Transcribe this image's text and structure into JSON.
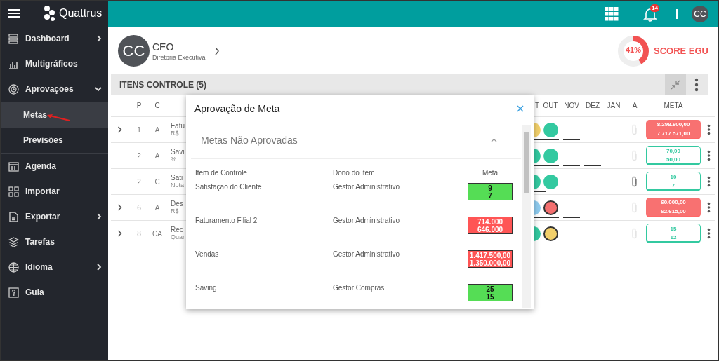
{
  "brand": "Quattrus",
  "sidebar": {
    "items": [
      {
        "label": "Dashboard",
        "submenu": true,
        "expanded": false
      },
      {
        "label": "Multigráficos",
        "submenu": false
      },
      {
        "label": "Aprovações",
        "submenu": true,
        "expanded": true,
        "children": [
          {
            "label": "Metas",
            "selected": true
          },
          {
            "label": "Previsões",
            "selected": false
          }
        ]
      },
      {
        "label": "Agenda",
        "submenu": false
      },
      {
        "label": "Importar",
        "submenu": false
      },
      {
        "label": "Exportar",
        "submenu": true,
        "expanded": false
      },
      {
        "label": "Tarefas",
        "submenu": false
      },
      {
        "label": "Idioma",
        "submenu": true,
        "expanded": false
      },
      {
        "label": "Guia",
        "submenu": false
      }
    ]
  },
  "topbar": {
    "notifications": "14",
    "avatar": "CC"
  },
  "profile": {
    "avatar": "CC",
    "role": "CEO",
    "department": "Diretoria Executiva"
  },
  "score": {
    "reading": "41%",
    "level": 0.41,
    "label": "SCORE EGU"
  },
  "section": {
    "title": "ITENS CONTROLE (5)"
  },
  "table": {
    "columns": [
      "P",
      "C",
      "T",
      "OUT",
      "NOV",
      "DEZ",
      "JAN",
      "A",
      "META"
    ],
    "rows": [
      {
        "p": "1",
        "c": "A",
        "name": "Fatu",
        "unit": "R$",
        "expandable": true,
        "months": [
          {
            "kind": "circle",
            "color": "#f2d06b",
            "underline": true,
            "outlined": false
          },
          {
            "kind": "circle",
            "color": "#33c9a0",
            "underline": true,
            "outlined": false
          },
          {
            "kind": "dash"
          },
          {
            "kind": "empty"
          },
          {
            "kind": "empty"
          }
        ],
        "attachment": false,
        "meta": {
          "met": false,
          "target": "8.298.800,00",
          "actual": "7.717.571,00"
        }
      },
      {
        "p": "2",
        "c": "A",
        "name": "Savi",
        "unit": "%",
        "expandable": false,
        "months": [
          {
            "kind": "circle",
            "color": "#33c9a0",
            "underline": true,
            "outlined": false
          },
          {
            "kind": "circle",
            "color": "#33c9a0",
            "underline": true,
            "outlined": false
          },
          {
            "kind": "dash"
          },
          {
            "kind": "dash"
          },
          {
            "kind": "empty"
          }
        ],
        "attachment": false,
        "meta": {
          "met": true,
          "target": "70,00",
          "actual": "50,00"
        }
      },
      {
        "p": "2",
        "c": "C",
        "name": "Sati",
        "unit": "Nota",
        "expandable": false,
        "months": [
          {
            "kind": "circle",
            "color": "#33c9a0",
            "underline": true,
            "outlined": false
          },
          {
            "kind": "circle",
            "color": "#33c9a0",
            "underline": false,
            "outlined": false
          },
          {
            "kind": "empty"
          },
          {
            "kind": "empty"
          },
          {
            "kind": "empty"
          }
        ],
        "attachment": true,
        "meta": {
          "met": true,
          "target": "10",
          "actual": "7"
        }
      },
      {
        "p": "6",
        "c": "A",
        "name": "Des",
        "unit": "R$",
        "expandable": true,
        "months": [
          {
            "kind": "circle",
            "color": "#8ecbef",
            "underline": true,
            "outlined": false
          },
          {
            "kind": "circle",
            "color": "#f36f6f",
            "underline": true,
            "outlined": true
          },
          {
            "kind": "dash"
          },
          {
            "kind": "empty"
          },
          {
            "kind": "empty"
          }
        ],
        "attachment": false,
        "meta": {
          "met": false,
          "target": "60.000,00",
          "actual": "62.615,00"
        }
      },
      {
        "p": "8",
        "c": "CA",
        "name": "Rec",
        "unit": "Quar",
        "expandable": true,
        "months": [
          {
            "kind": "circle",
            "color": "#33c9a0",
            "underline": false,
            "outlined": false
          },
          {
            "kind": "circle",
            "color": "#f2d06b",
            "underline": false,
            "outlined": true
          },
          {
            "kind": "empty"
          },
          {
            "kind": "empty"
          },
          {
            "kind": "empty"
          }
        ],
        "attachment": false,
        "meta": {
          "met": true,
          "target": "15",
          "actual": "12"
        }
      }
    ]
  },
  "dialog": {
    "title": "Aprovação de Meta",
    "section": {
      "title": "Metas Não Aprovadas",
      "expanded": true
    },
    "columns": [
      "Item de Controle",
      "Dono do item",
      "Meta"
    ],
    "rows": [
      {
        "item": "Satisfação do Cliente",
        "owner": "Gestor Administrativo",
        "met": true,
        "target": "9",
        "actual": "7"
      },
      {
        "item": "Faturamento Filial 2",
        "owner": "Gestor Administrativo",
        "met": false,
        "target": "714.000",
        "actual": "646.000"
      },
      {
        "item": "Vendas",
        "owner": "Gestor Administrativo",
        "met": false,
        "target": "1.417.500,00",
        "actual": "1.350.000,00"
      },
      {
        "item": "Saving",
        "owner": "Gestor Compras",
        "met": true,
        "target": "25",
        "actual": "15"
      }
    ]
  }
}
